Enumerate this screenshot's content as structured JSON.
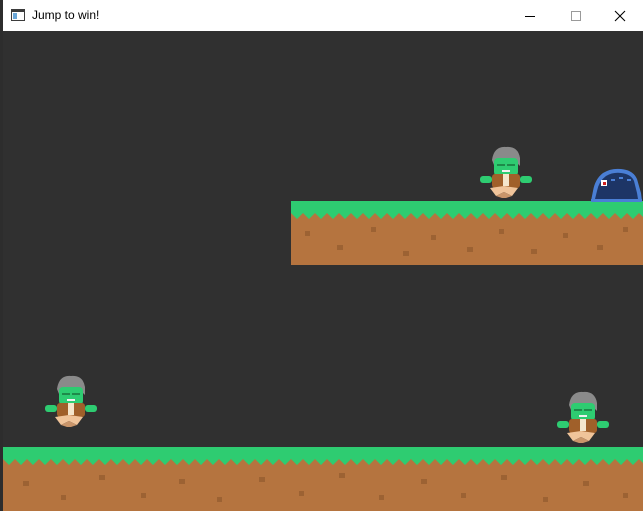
{
  "window": {
    "title": "Jump to win!",
    "app_icon": "window-app-icon",
    "controls": [
      "minimize-icon",
      "maximize-icon",
      "close-icon"
    ]
  },
  "game": {
    "background_color": "#303030",
    "grass_color": "#2ecc71",
    "dirt_color": "#b5743f",
    "player_sprite": "green-orc-gray-hair",
    "enemy_sprite": "blue-slime",
    "players_visible": 3,
    "enemies_visible": 1
  }
}
